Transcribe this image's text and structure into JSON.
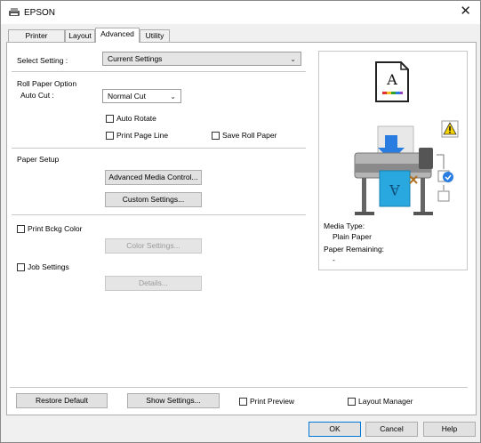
{
  "window": {
    "title": "EPSON",
    "close_glyph": "✕"
  },
  "tabs": [
    {
      "label": "Printer Settings",
      "active": false
    },
    {
      "label": "Layout",
      "active": false
    },
    {
      "label": "Advanced",
      "active": true
    },
    {
      "label": "Utility",
      "active": false
    }
  ],
  "select_setting": {
    "label": "Select Setting :",
    "value": "Current Settings"
  },
  "roll_paper": {
    "heading": "Roll Paper Option",
    "auto_cut_label": "Auto Cut :",
    "auto_cut_value": "Normal Cut",
    "auto_rotate": "Auto Rotate",
    "print_page_line": "Print Page Line",
    "save_roll_paper": "Save Roll Paper"
  },
  "paper_setup": {
    "heading": "Paper Setup",
    "advanced_media_control": "Advanced Media Control...",
    "custom_settings": "Custom Settings..."
  },
  "print_bckg_color": {
    "label": "Print Bckg Color",
    "button": "Color Settings..."
  },
  "job_settings": {
    "label": "Job Settings",
    "button": "Details..."
  },
  "preview": {
    "media_type_label": "Media Type:",
    "media_type_value": "Plain Paper",
    "paper_remaining_label": "Paper Remaining:",
    "paper_remaining_value": "-",
    "sheet_letter": "A"
  },
  "bottom": {
    "restore_default": "Restore Default",
    "show_settings": "Show Settings...",
    "print_preview": "Print Preview",
    "layout_manager": "Layout Manager"
  },
  "footer": {
    "ok": "OK",
    "cancel": "Cancel",
    "help": "Help"
  },
  "colors": {
    "accent": "#0078d7",
    "printer_blue": "#29a8e0",
    "warning": "#f5d200"
  }
}
